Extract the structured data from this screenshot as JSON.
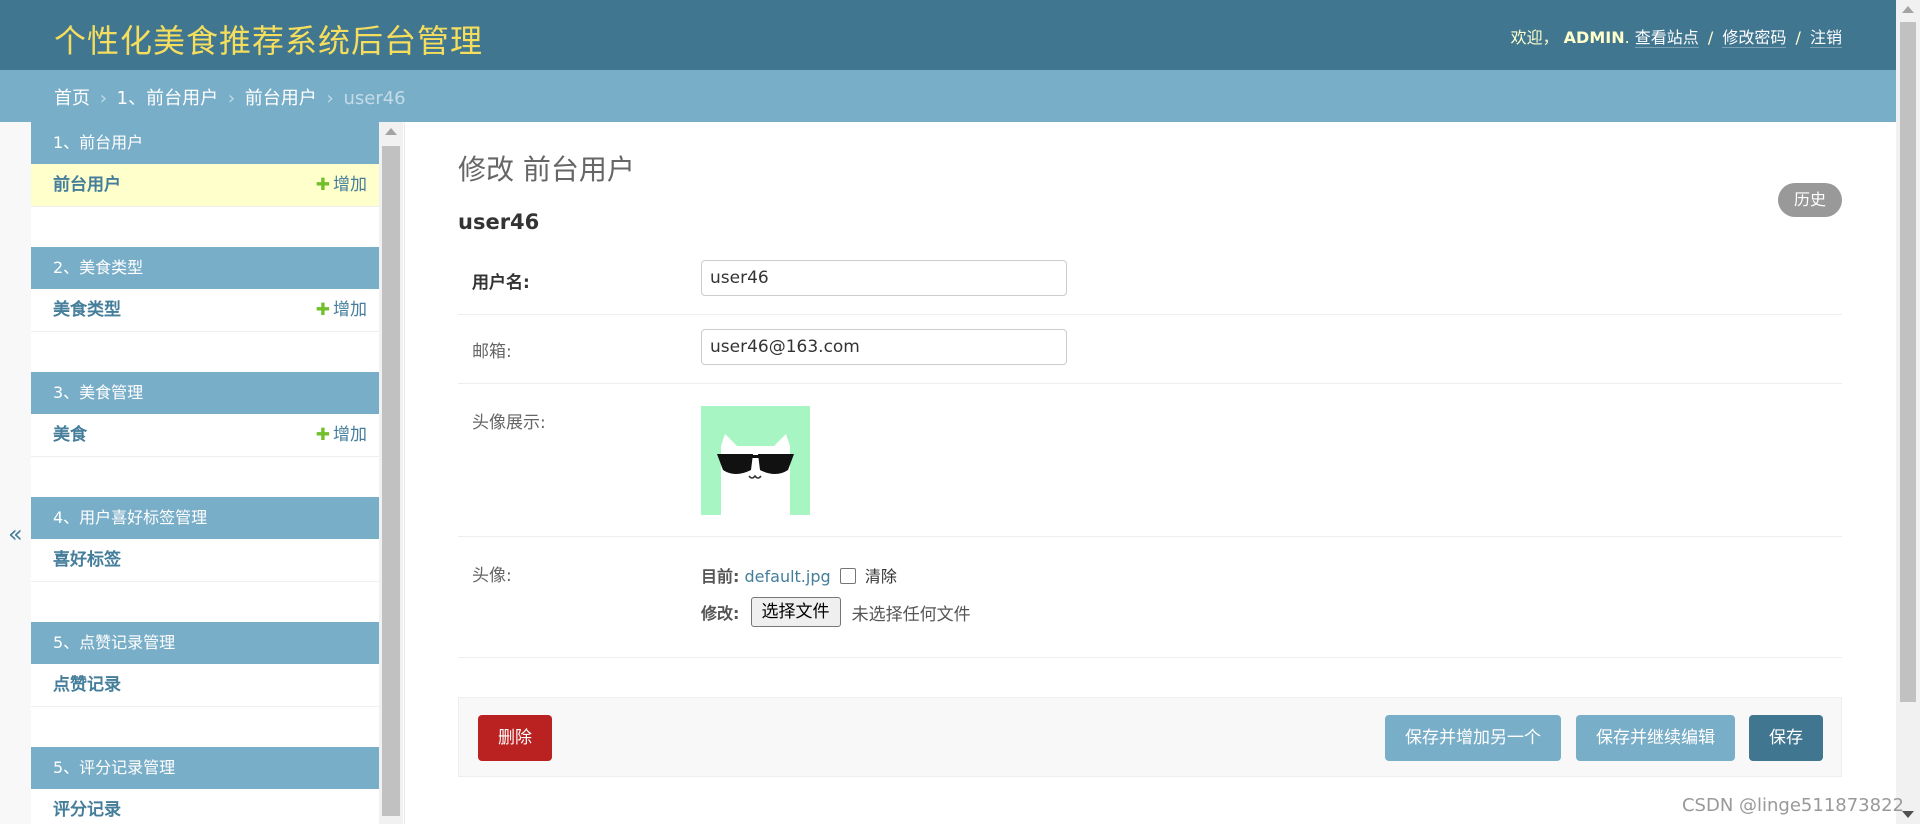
{
  "header": {
    "site_title": "个性化美食推荐系统后台管理",
    "welcome": "欢迎，",
    "username": "ADMIN",
    "period": ".",
    "view_site": "查看站点",
    "change_password": "修改密码",
    "logout": "注销",
    "separator": "/"
  },
  "breadcrumbs": {
    "home": "首页",
    "app": "1、前台用户",
    "model": "前台用户",
    "current": "user46",
    "arrow": "›"
  },
  "nav_toggle": "«",
  "sidebar": {
    "add_label": "增加",
    "modules": [
      {
        "caption": "1、前台用户",
        "item": "前台用户",
        "has_add": true,
        "current": true
      },
      {
        "caption": "2、美食类型",
        "item": "美食类型",
        "has_add": true,
        "current": false
      },
      {
        "caption": "3、美食管理",
        "item": "美食",
        "has_add": true,
        "current": false
      },
      {
        "caption": "4、用户喜好标签管理",
        "item": "喜好标签",
        "has_add": false,
        "current": false
      },
      {
        "caption": "5、点赞记录管理",
        "item": "点赞记录",
        "has_add": false,
        "current": false
      },
      {
        "caption": "5、评分记录管理",
        "item": "评分记录",
        "has_add": false,
        "current": false
      }
    ]
  },
  "main": {
    "page_title": "修改 前台用户",
    "history_button": "历史",
    "object_name": "user46",
    "fields": {
      "username_label": "用户名:",
      "username_value": "user46",
      "email_label": "邮箱:",
      "email_value": "user46@163.com",
      "avatar_display_label": "头像展示:",
      "avatar_label": "头像:",
      "current_label": "目前:",
      "current_file": "default.jpg",
      "clear_label": "清除",
      "change_label": "修改:",
      "choose_file_button": "选择文件",
      "no_file_text": "未选择任何文件"
    },
    "buttons": {
      "delete": "删除",
      "save_add_another": "保存并增加另一个",
      "save_continue": "保存并继续编辑",
      "save": "保存"
    }
  },
  "watermark": "CSDN @linge511873822",
  "colors": {
    "header_bg": "#417690",
    "breadcrumb_bg": "#79aec8",
    "title_yellow": "#f5dd5d",
    "delete_red": "#ba2121",
    "avatar_bg": "#a8f5c4"
  }
}
